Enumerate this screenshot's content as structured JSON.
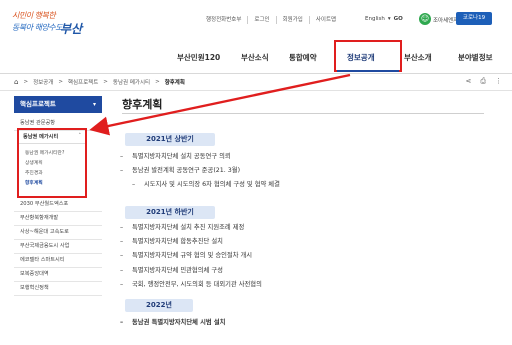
{
  "header": {
    "logo": {
      "line1": "시민이 행복한",
      "line2": "동북아 해양수도",
      "name": "부산"
    },
    "utility_links": [
      "행정전화번호부",
      "로그인",
      "회원가입",
      "사이트맵"
    ],
    "language": {
      "label": "English",
      "go": "GO"
    },
    "smile_label": "조아세엔자(보통)",
    "cta_button": "코로나19"
  },
  "main_nav": {
    "items": [
      "부산민원120",
      "부산소식",
      "통합예약",
      "정보공개",
      "부산소개",
      "분야별정보"
    ],
    "active": "정보공개"
  },
  "breadcrumb": {
    "items": [
      "정보공개",
      "핵심프로젝트",
      "동남권 메가시티"
    ],
    "current": "향후계획",
    "separator": ">"
  },
  "sidebar": {
    "header": "핵심프로젝트",
    "items_top": [
      "동남권 관문공항"
    ],
    "section": {
      "title": "동남권 메가시티",
      "children": [
        "동남권 메가시티란?",
        "상생계획",
        "추진경과",
        "향후계획"
      ],
      "active_child": "향후계획"
    },
    "items_bottom": [
      "2030 부산월드엑스포",
      "부산항북항재개발",
      "사상~해운대 고속도로",
      "부산국제금융도시 사업",
      "에코델타 스마트시티",
      "보복중앙대역",
      "보행혁신정책"
    ]
  },
  "content": {
    "title": "향후계획",
    "sections": [
      {
        "heading": "2021년 상반기",
        "items": [
          "특별지방자치단체 설치 공동연구 의뢰",
          "동남권 발전계획 공동연구 준공(21. 3월)",
          "시도지사 및 시도의장 6자 협의체 구성 및 협약 체결"
        ]
      },
      {
        "heading": "2021년 하반기",
        "items": [
          "특별지방자치단체 설치 추진 지원조례 제정",
          "특별지방자치단체 합동추진단 설치",
          "특별지방자치단체 규약 협의 및 승인절차 개시",
          "특별지방자치단체 민관협의체 구성",
          "국회, 행정안전부, 시도의회 등 대외기관 사전협의"
        ]
      },
      {
        "heading": "2022년",
        "items": [
          "동남권 특별지방자치단체 시범 설치"
        ]
      }
    ]
  },
  "icons": {
    "home": "home-icon",
    "share": "share-icon",
    "print": "print-icon",
    "more": "more-icon",
    "smile": "smile-icon"
  },
  "colors": {
    "primary": "#1f4aa0",
    "highlight": "#e01e1e",
    "pill_bg": "#dce6f5"
  }
}
